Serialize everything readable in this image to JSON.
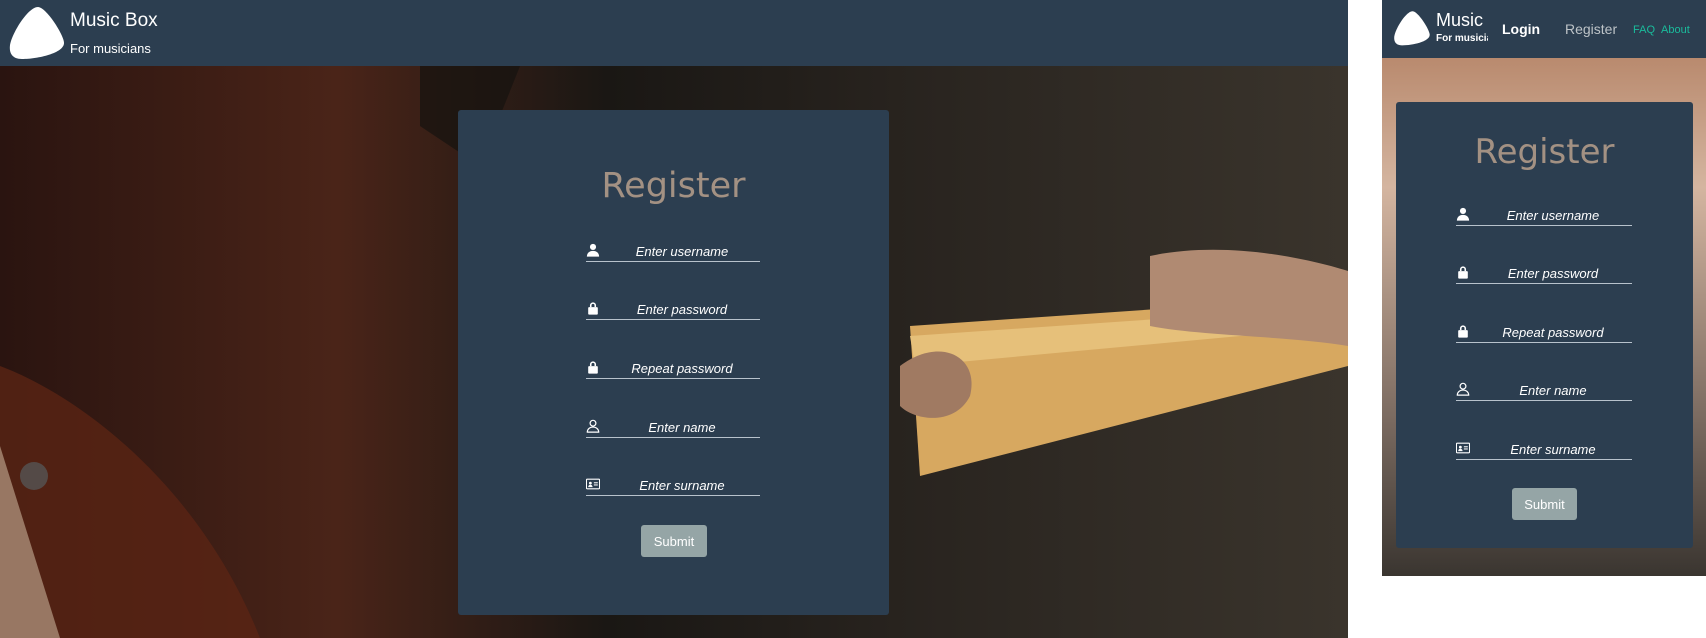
{
  "app": {
    "brand": "Music Box",
    "tagline": "For musicians"
  },
  "mobile_nav": {
    "login": "Login",
    "register": "Register",
    "faq": "FAQ",
    "about": "About"
  },
  "form": {
    "title": "Register",
    "fields": [
      {
        "placeholder": "Enter username",
        "icon": "user-icon",
        "value": ""
      },
      {
        "placeholder": "Enter password",
        "icon": "lock-icon",
        "value": ""
      },
      {
        "placeholder": "Repeat password",
        "icon": "lock-icon",
        "value": ""
      },
      {
        "placeholder": "Enter name",
        "icon": "user-outline-icon",
        "value": ""
      },
      {
        "placeholder": "Enter surname",
        "icon": "id-card-icon",
        "value": ""
      }
    ],
    "submit_label": "Submit"
  },
  "colors": {
    "navbar": "#2c3e50",
    "card": "#2c3e50",
    "title": "#a39183",
    "submit": "#95a5a6",
    "nav_accent": "#1abc9c"
  }
}
